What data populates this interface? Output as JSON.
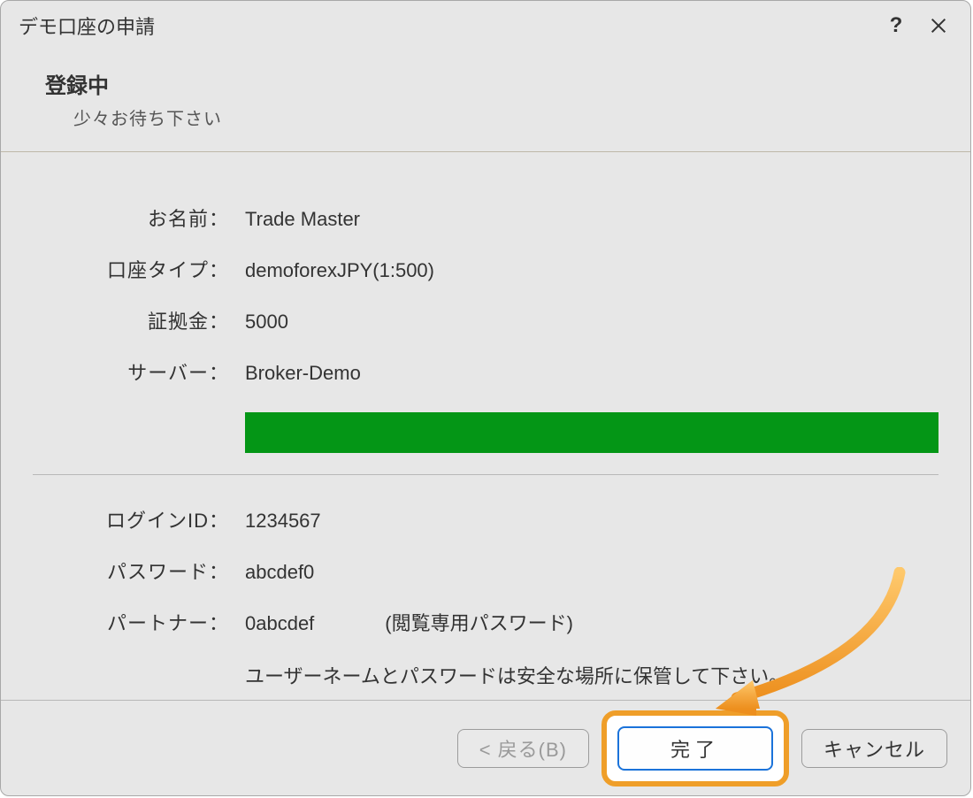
{
  "titlebar": {
    "title": "デモ口座の申請",
    "help_symbol": "?",
    "close_label": "close"
  },
  "header": {
    "title": "登録中",
    "subtitle": "少々お待ち下さい"
  },
  "account": {
    "name_label": "お名前：",
    "name_value": "Trade Master",
    "type_label": "口座タイプ：",
    "type_value": "demoforexJPY(1:500)",
    "deposit_label": "証拠金：",
    "deposit_value": "5000",
    "server_label": "サーバー：",
    "server_value": "Broker-Demo"
  },
  "progress": {
    "percent": 100,
    "color": "#049616"
  },
  "credentials": {
    "login_label": "ログインID：",
    "login_value": "1234567",
    "password_label": "パスワード：",
    "password_value": "abcdef0",
    "partner_label": "パートナー：",
    "partner_value": "0abcdef",
    "partner_note": "(閲覧専用パスワード)"
  },
  "safety_note": "ユーザーネームとパスワードは安全な場所に保管して下さい。",
  "footer": {
    "back_label": "< 戻る(B)",
    "finish_label": "完了",
    "cancel_label": "キャンセル"
  }
}
